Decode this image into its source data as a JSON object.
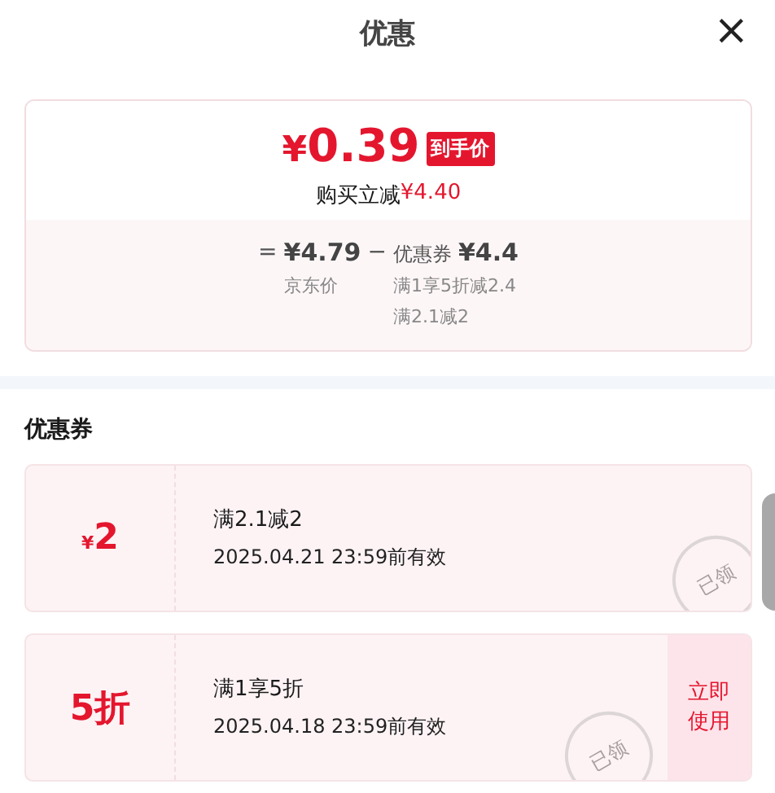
{
  "header": {
    "title": "优惠",
    "close": "×"
  },
  "price_card": {
    "price_symbol": "¥",
    "price": "0.39",
    "badge": "到手价",
    "saving_label": "购买立减",
    "saving_amount": "¥4.40",
    "breakdown": {
      "equals": "=",
      "base_price": "¥4.79",
      "base_label": "京东价",
      "minus": "−",
      "coupon_label": "优惠券",
      "coupon_amount": "¥4.4",
      "coupon_details": [
        "满1享5折减2.4",
        "满2.1减2"
      ]
    }
  },
  "coupons_section": {
    "title": "优惠券",
    "coupons": [
      {
        "kind": "amount",
        "symbol": "¥",
        "value": "2",
        "condition": "满2.1减2",
        "validity": "2025.04.21 23:59前有效",
        "stamp": "已领"
      },
      {
        "kind": "discount",
        "value": "5折",
        "condition": "满1享5折",
        "validity": "2025.04.18 23:59前有效",
        "stamp": "已领",
        "action": "立即使用"
      }
    ]
  }
}
